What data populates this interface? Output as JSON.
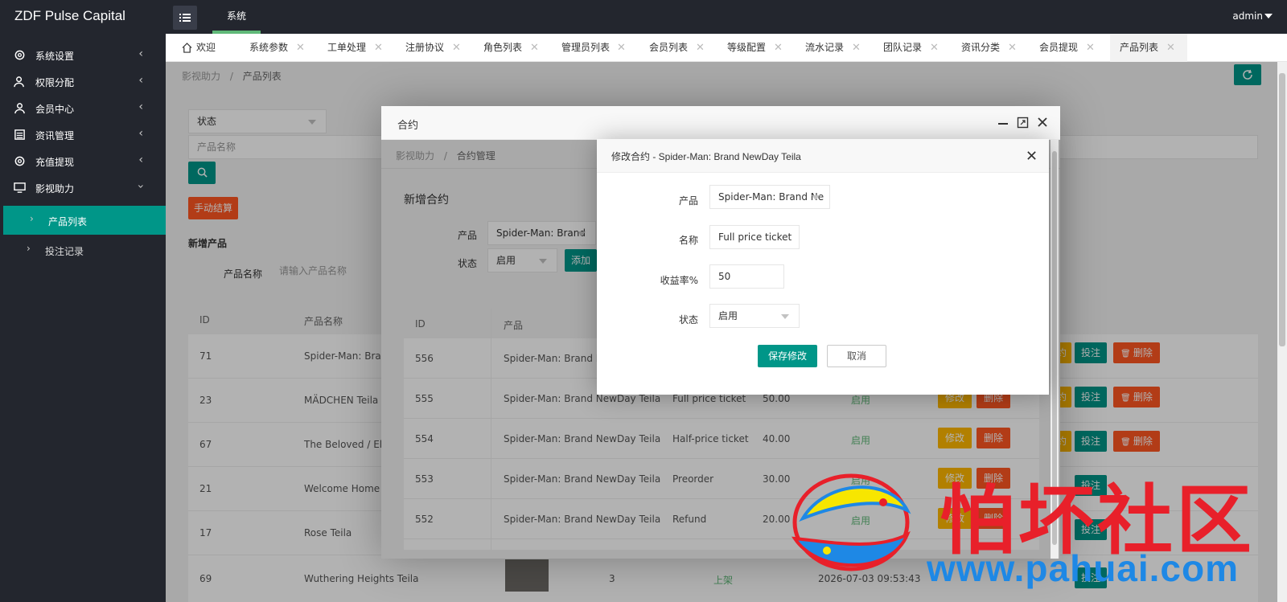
{
  "app": {
    "brand": "ZDF Pulse Capital",
    "top_tab": "系统",
    "user": "admin"
  },
  "sidebar": {
    "items": [
      {
        "label": "系统设置",
        "icon": "gear-icon"
      },
      {
        "label": "权限分配",
        "icon": "users-icon"
      },
      {
        "label": "会员中心",
        "icon": "user-icon"
      },
      {
        "label": "资讯管理",
        "icon": "list-icon"
      },
      {
        "label": "充值提现",
        "icon": "gear-icon"
      },
      {
        "label": "影视助力",
        "icon": "monitor-icon"
      }
    ],
    "sub_items": [
      {
        "label": "产品列表",
        "active": true
      },
      {
        "label": "投注记录",
        "active": false
      }
    ]
  },
  "tabs": [
    {
      "label": "欢迎",
      "icon": "home-icon"
    },
    {
      "label": "系统参数"
    },
    {
      "label": "工单处理"
    },
    {
      "label": "注册协议"
    },
    {
      "label": "角色列表"
    },
    {
      "label": "管理员列表"
    },
    {
      "label": "会员列表"
    },
    {
      "label": "等级配置"
    },
    {
      "label": "流水记录"
    },
    {
      "label": "团队记录"
    },
    {
      "label": "资讯分类"
    },
    {
      "label": "会员提现"
    },
    {
      "label": "产品列表",
      "active": true
    }
  ],
  "close_glyph": "✕",
  "main": {
    "breadcrumb": [
      "影视助力",
      "产品列表"
    ],
    "crumb_sep": "/",
    "status_select": "状态",
    "name_placeholder": "产品名称",
    "manual_settle": "手动结算",
    "new_product_title": "新增产品",
    "product_name_label": "产品名称",
    "product_name_placeholder": "请输入产品名称",
    "table_headers": [
      "ID",
      "产品名称"
    ],
    "rows": [
      {
        "id": "71",
        "name": "Spider-Man: Brand"
      },
      {
        "id": "23",
        "name": "MÄDCHEN Teila"
      },
      {
        "id": "67",
        "name": "The Beloved / El s"
      },
      {
        "id": "21",
        "name": "Welcome Home Ba"
      },
      {
        "id": "17",
        "name": "Rose Teila"
      },
      {
        "id": "69",
        "name": "Wuthering Heights Teila"
      }
    ],
    "last_row": {
      "count": "3",
      "status": "上架",
      "time": "2026-07-03 09:53:43"
    },
    "btn_bet": "投注",
    "btn_delete": "删除",
    "btn_contract_partial": "约"
  },
  "popup": {
    "title": "合约",
    "breadcrumb": [
      "影视助力",
      "合约管理"
    ],
    "add_title": "新增合约",
    "product_label": "产品",
    "product_value": "Spider-Man: Brand N",
    "status_label": "状态",
    "status_value": "启用",
    "add_button": "添加",
    "table_headers": [
      "ID",
      "产品"
    ],
    "rows": [
      {
        "id": "556",
        "product": "Spider-Man: Brand New",
        "name": "",
        "rate": "",
        "status": ""
      },
      {
        "id": "555",
        "product": "Spider-Man: Brand NewDay Teila",
        "name": "Full price ticket",
        "rate": "50.00",
        "status": "启用"
      },
      {
        "id": "554",
        "product": "Spider-Man: Brand NewDay Teila",
        "name": "Half-price ticket",
        "rate": "40.00",
        "status": "启用"
      },
      {
        "id": "553",
        "product": "Spider-Man: Brand NewDay Teila",
        "name": "Preorder",
        "rate": "30.00",
        "status": "启用"
      },
      {
        "id": "552",
        "product": "Spider-Man: Brand NewDay Teila",
        "name": "Refund",
        "rate": "20.00",
        "status": "启用"
      }
    ],
    "btn_edit": "修改",
    "btn_delete": "删除"
  },
  "dialog": {
    "title": "修改合约 - Spider-Man: Brand NewDay Teila",
    "fields": {
      "product_label": "产品",
      "product_value": "Spider-Man: Brand Ne",
      "name_label": "名称",
      "name_value": "Full price ticket",
      "rate_label": "收益率%",
      "rate_value": "50",
      "status_label": "状态",
      "status_value": "启用"
    },
    "save_button": "保存修改",
    "cancel_button": "取消"
  },
  "watermark": {
    "text": "怕坏社区",
    "url": "www.pahuai.com"
  },
  "colors": {
    "accent": "#009688",
    "danger": "#ff5722",
    "warn": "#ffb800",
    "dark": "#23262e",
    "highlight_bar": "#5fb878"
  }
}
